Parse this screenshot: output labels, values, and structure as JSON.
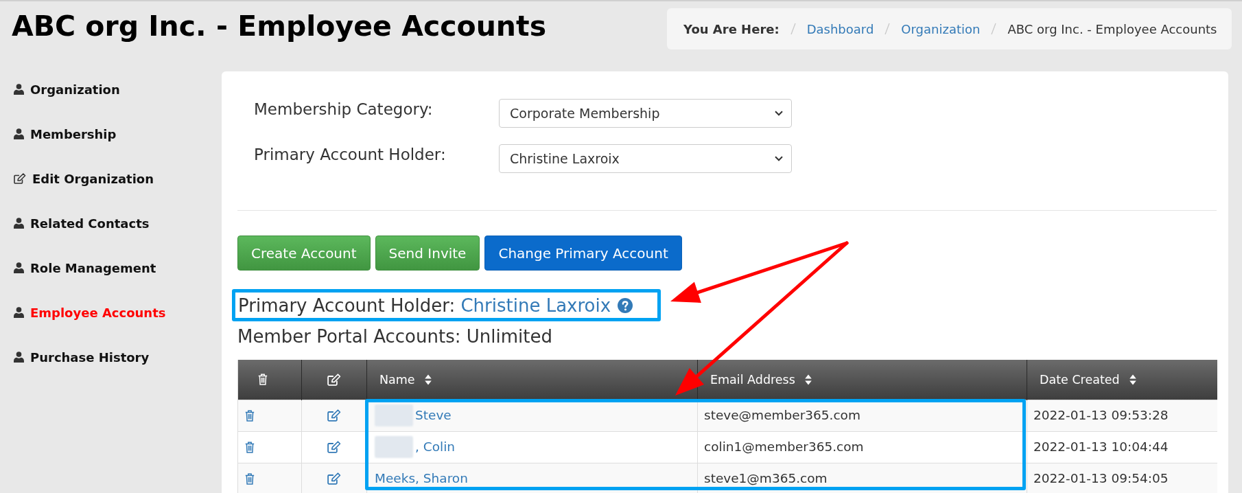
{
  "page_title": "ABC org Inc. - Employee Accounts",
  "breadcrumb": {
    "label": "You Are Here:",
    "items": [
      {
        "text": "Dashboard",
        "kind": "link"
      },
      {
        "text": "Organization",
        "kind": "link"
      },
      {
        "text": "ABC org Inc. - Employee Accounts",
        "kind": "current"
      }
    ]
  },
  "sidebar": {
    "items": [
      {
        "label": "Organization",
        "kind": "view",
        "selected": false
      },
      {
        "label": "Membership",
        "kind": "view",
        "selected": false
      },
      {
        "label": "Edit Organization",
        "kind": "edit",
        "selected": false
      },
      {
        "label": "Related Contacts",
        "kind": "view",
        "selected": false
      },
      {
        "label": "Role Management",
        "kind": "view",
        "selected": false
      },
      {
        "label": "Employee Accounts",
        "kind": "view",
        "selected": true
      },
      {
        "label": "Purchase History",
        "kind": "view",
        "selected": false
      }
    ]
  },
  "form": {
    "fields": [
      {
        "label": "Membership Category:",
        "value": "Corporate Membership"
      },
      {
        "label": "Primary Account Holder:",
        "value": "Christine Laxroix"
      }
    ]
  },
  "buttons": [
    {
      "label": "Create Account",
      "kind": "success"
    },
    {
      "label": "Send Invite",
      "kind": "success"
    },
    {
      "label": "Change Primary Account",
      "kind": "primary"
    }
  ],
  "primary_holder": {
    "label": "Primary Account Holder:",
    "name": "Christine Laxroix",
    "highlighted": true
  },
  "portal_accounts": "Member Portal Accounts: Unlimited",
  "table": {
    "columns": [
      {
        "kind": "delete",
        "sortable": false
      },
      {
        "kind": "edit",
        "sortable": false
      },
      {
        "kind": "name",
        "label": "Name",
        "sortable": true
      },
      {
        "kind": "email",
        "label": "Email Address",
        "sortable": true
      },
      {
        "kind": "date",
        "label": "Date Created",
        "sortable": true
      }
    ],
    "rows": [
      {
        "name": "Steve",
        "redacted": true,
        "email": "steve@member365.com",
        "date": "2022-01-13 09:53:28"
      },
      {
        "name": ", Colin",
        "redacted": true,
        "email": "colin1@member365.com",
        "date": "2022-01-13 10:04:44"
      },
      {
        "name": "Meeks, Sharon",
        "redacted": false,
        "email": "steve1@m365.com",
        "date": "2022-01-13 09:54:05"
      }
    ]
  }
}
